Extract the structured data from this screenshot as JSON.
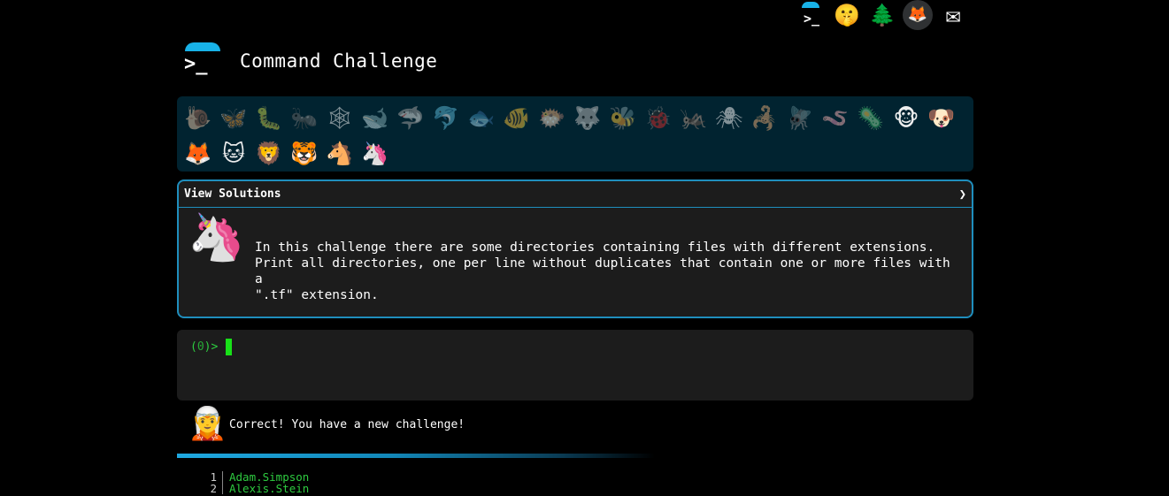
{
  "top_icons": [
    {
      "name": "commandchallenge-icon",
      "glyph": ">_"
    },
    {
      "name": "shushing-face-icon",
      "glyph": "🤫"
    },
    {
      "name": "evergreen-tree-icon",
      "glyph": "🌲"
    },
    {
      "name": "gitlab-icon",
      "glyph": "🦊"
    },
    {
      "name": "envelope-icon",
      "glyph": "✉"
    }
  ],
  "header": {
    "logo_glyph": ">_",
    "title": "Command Challenge"
  },
  "animals": [
    {
      "name": "snail",
      "glyph": "🐌",
      "dim": true
    },
    {
      "name": "butterfly",
      "glyph": "🦋",
      "dim": true
    },
    {
      "name": "caterpillar",
      "glyph": "🐛",
      "dim": true
    },
    {
      "name": "ant",
      "glyph": "🐜",
      "dim": true
    },
    {
      "name": "spider-web",
      "glyph": "🕸",
      "dim": true
    },
    {
      "name": "whale",
      "glyph": "🐋",
      "dim": true
    },
    {
      "name": "shark",
      "glyph": "🦈",
      "dim": true
    },
    {
      "name": "dolphin",
      "glyph": "🐬",
      "dim": true
    },
    {
      "name": "fish",
      "glyph": "🐟",
      "dim": true
    },
    {
      "name": "tropical-fish",
      "glyph": "🐠",
      "dim": true
    },
    {
      "name": "blowfish",
      "glyph": "🐡",
      "dim": true
    },
    {
      "name": "wolf",
      "glyph": "🐺",
      "dim": true
    },
    {
      "name": "bee",
      "glyph": "🐝",
      "dim": true
    },
    {
      "name": "ladybug",
      "glyph": "🐞",
      "dim": true
    },
    {
      "name": "cricket",
      "glyph": "🦗",
      "dim": true
    },
    {
      "name": "spider",
      "glyph": "🕷",
      "dim": true
    },
    {
      "name": "scorpion",
      "glyph": "🦂",
      "dim": true
    },
    {
      "name": "fly",
      "glyph": "🪰",
      "dim": true
    },
    {
      "name": "worm",
      "glyph": "🪱",
      "dim": true
    },
    {
      "name": "microbe",
      "glyph": "🦠",
      "dim": true
    },
    {
      "name": "monkey",
      "glyph": "🐵",
      "dim": false
    },
    {
      "name": "dog",
      "glyph": "🐶",
      "dim": false
    },
    {
      "name": "fox",
      "glyph": "🦊",
      "dim": false
    },
    {
      "name": "cat",
      "glyph": "🐱",
      "dim": false
    },
    {
      "name": "lion",
      "glyph": "🦁",
      "dim": false
    },
    {
      "name": "tiger",
      "glyph": "🐯",
      "dim": false
    },
    {
      "name": "horse",
      "glyph": "🐴",
      "dim": false
    },
    {
      "name": "unicorn",
      "glyph": "🦄",
      "dim": false
    }
  ],
  "solutions": {
    "header_label": "View Solutions",
    "chevron": "❯",
    "avatar_glyph": "🦄",
    "description": "In this challenge there are some directories containing files with different extensions.\nPrint all directories, one per line without duplicates that contain one or more files with a\n\".tf\" extension."
  },
  "terminal": {
    "prompt_open": "(",
    "prompt_count": "0",
    "prompt_close": ")>"
  },
  "feedback": {
    "avatar_glyph": "🧝",
    "message": "Correct! You have a new challenge!"
  },
  "progress": {
    "fraction": 0.6
  },
  "output": [
    {
      "num": "1",
      "text": "Adam.Simpson"
    },
    {
      "num": "2",
      "text": "Alexis.Stein"
    }
  ]
}
